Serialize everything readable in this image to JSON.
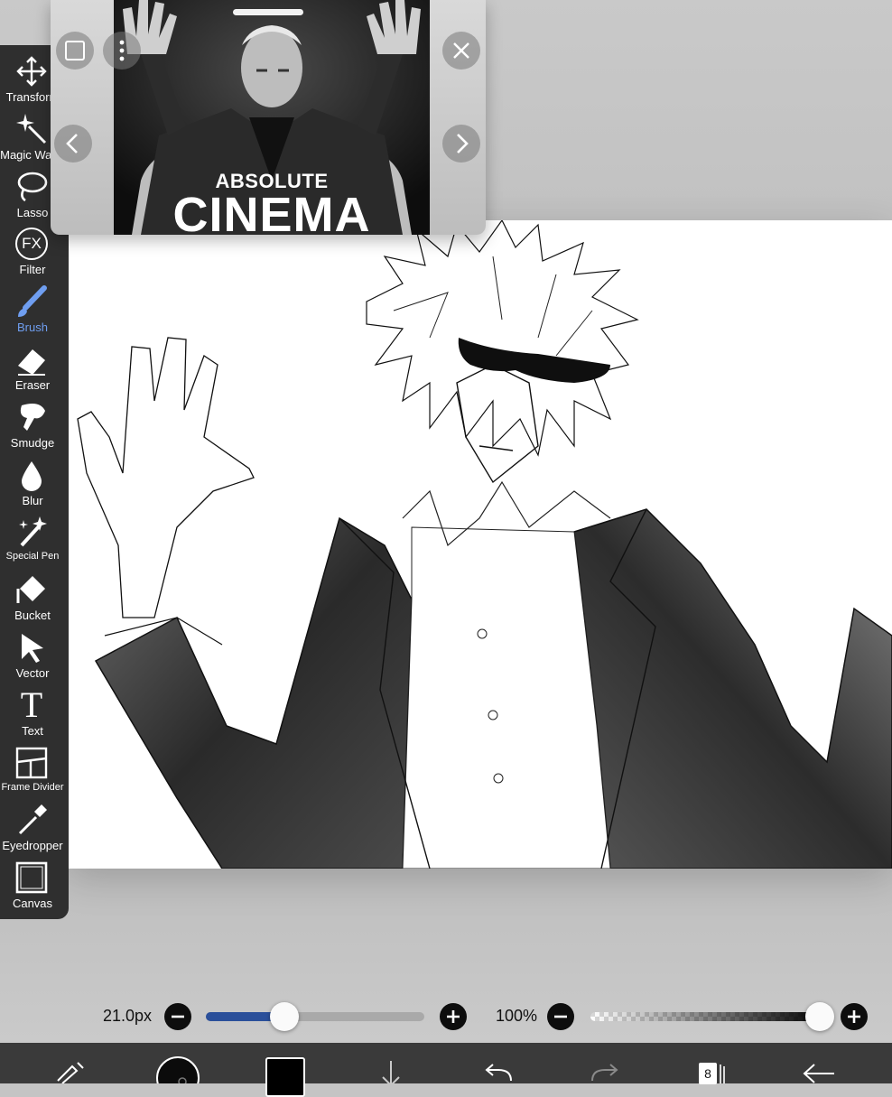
{
  "tools": [
    {
      "label": "Transform",
      "icon": "move-arrows-icon"
    },
    {
      "label": "Magic Wand",
      "icon": "magic-wand-icon"
    },
    {
      "label": "Lasso",
      "icon": "lasso-icon"
    },
    {
      "label": "Filter",
      "icon": "fx-filter-icon",
      "glyph": "FX"
    },
    {
      "label": "Brush",
      "icon": "brush-icon",
      "active": true
    },
    {
      "label": "Eraser",
      "icon": "eraser-icon"
    },
    {
      "label": "Smudge",
      "icon": "smudge-icon"
    },
    {
      "label": "Blur",
      "icon": "blur-drop-icon"
    },
    {
      "label": "Special Pen",
      "icon": "special-pen-icon"
    },
    {
      "label": "Bucket",
      "icon": "bucket-icon"
    },
    {
      "label": "Vector",
      "icon": "vector-cursor-icon"
    },
    {
      "label": "Text",
      "icon": "text-icon",
      "glyph": "T"
    },
    {
      "label": "Frame Divider",
      "icon": "frame-divider-icon"
    },
    {
      "label": "Eyedropper",
      "icon": "eyedropper-icon"
    },
    {
      "label": "Canvas",
      "icon": "canvas-icon"
    }
  ],
  "reference": {
    "caption_top": "ABSOLUTE",
    "caption_main": "CINEMA"
  },
  "brush_size": {
    "value_text": "21.0px",
    "fill_fraction": 0.36
  },
  "opacity": {
    "value_text": "100%",
    "fill_fraction": 1.0
  },
  "colors": {
    "accent_blue": "#2a4f9a",
    "active_tool": "#6f9ef0",
    "toolbar_bg": "#2f2f2f",
    "bottom_bar_bg": "#3a3a3a"
  },
  "layers": {
    "count": "8"
  },
  "bottom_icons": [
    "brush-settings-icon",
    "brush-preview-icon",
    "color-swatch-icon",
    "download-arrow-icon",
    "undo-icon",
    "redo-icon",
    "layers-icon",
    "back-arrow-icon"
  ]
}
